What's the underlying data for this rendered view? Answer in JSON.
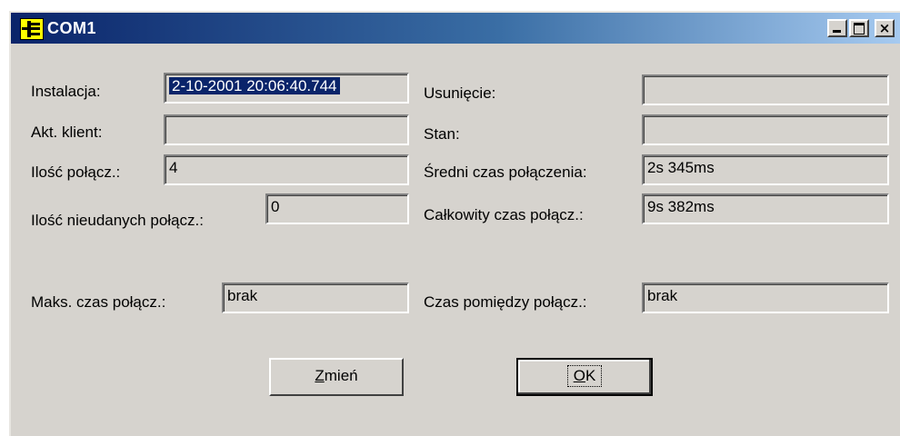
{
  "window": {
    "title": "COM1",
    "app_icon": "plug-icon",
    "controls": {
      "minimize": "minimize-icon",
      "maximize": "maximize-icon",
      "close": "×"
    }
  },
  "left": {
    "instalacja": {
      "label": "Instalacja:",
      "value": "2-10-2001 20:06:40.744"
    },
    "akt_klient": {
      "label": "Akt. klient:",
      "value": ""
    },
    "ilosc_polacz": {
      "label": "Ilość połącz.:",
      "value": "4"
    },
    "ilosc_nieudanych": {
      "label": "Ilość nieudanych połącz.:",
      "value": "0"
    },
    "maks_czas": {
      "label": "Maks. czas połącz.:",
      "value": "brak"
    }
  },
  "right": {
    "usuniecie": {
      "label": "Usunięcie:",
      "value": ""
    },
    "stan": {
      "label": "Stan:",
      "value": ""
    },
    "sredni_czas": {
      "label": "Średni czas połączenia:",
      "value": "2s 345ms"
    },
    "calkowity_czas": {
      "label": "Całkowity czas połącz.:",
      "value": "9s 382ms"
    },
    "czas_pomiedzy": {
      "label": "Czas pomiędzy połącz.:",
      "value": "brak"
    }
  },
  "buttons": {
    "zmien": {
      "mnemonic": "Z",
      "rest": "mień"
    },
    "ok": {
      "mnemonic": "O",
      "rest": "K"
    }
  },
  "colors": {
    "face": "#d6d3ce",
    "title_start": "#0a246a",
    "title_end": "#a6caf0",
    "selection": "#0a246a"
  }
}
